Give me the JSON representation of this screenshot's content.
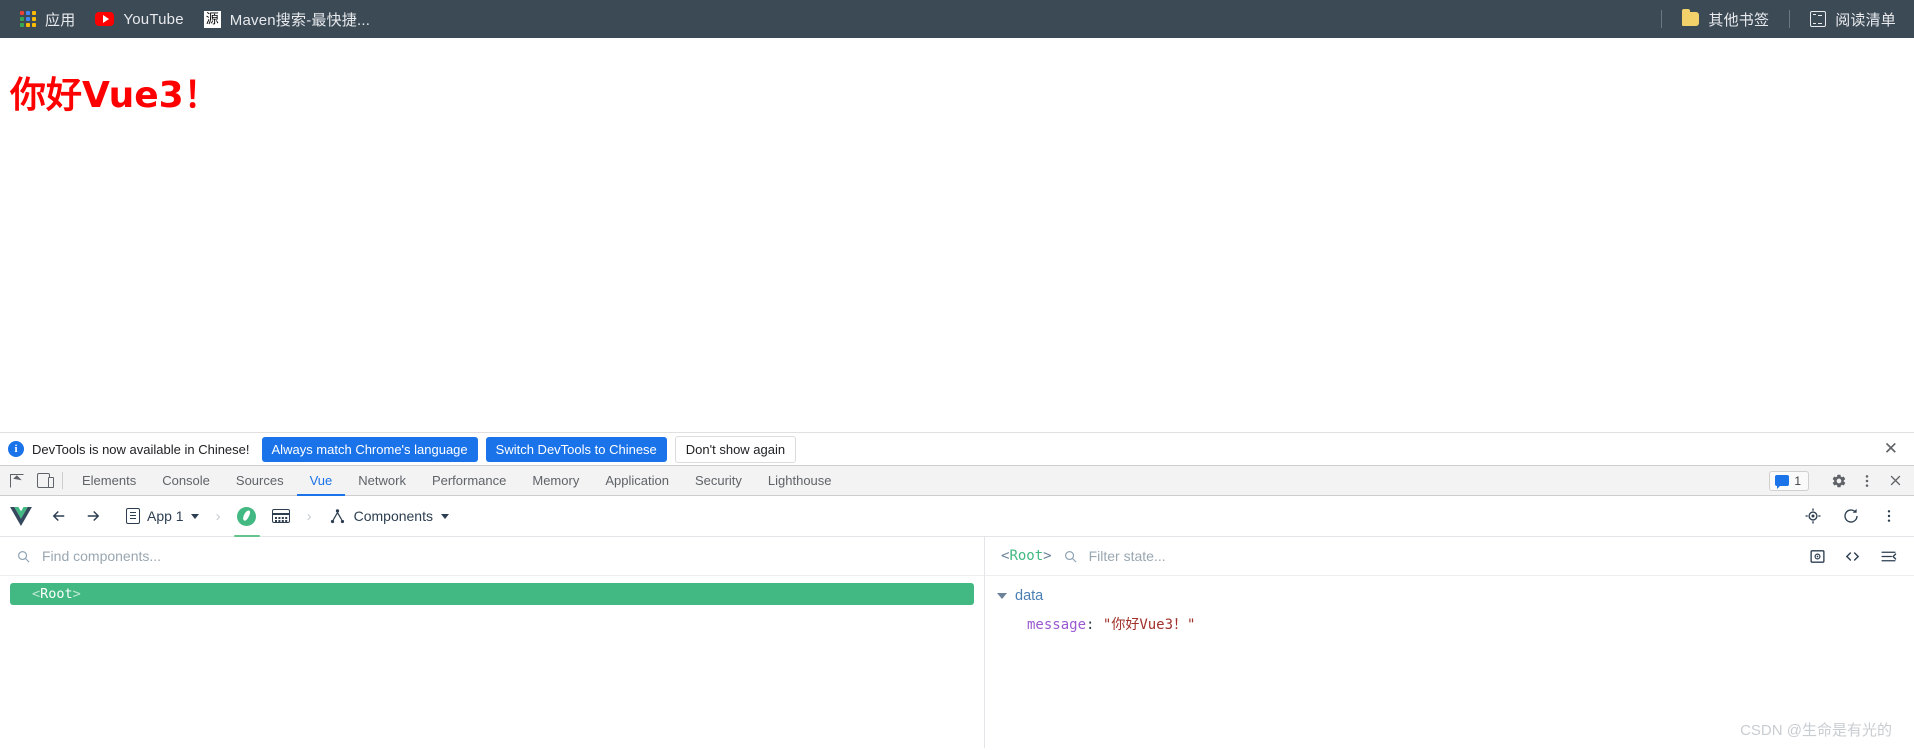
{
  "bookmark_bar": {
    "items": [
      {
        "icon": "apps-grid-icon",
        "label": "应用"
      },
      {
        "icon": "youtube-icon",
        "label": "YouTube"
      },
      {
        "icon": "maven-favicon",
        "favicon_text": "源",
        "label": "Maven搜索-最快捷..."
      }
    ],
    "right": [
      {
        "icon": "folder-icon",
        "label": "其他书签"
      },
      {
        "icon": "reading-list-icon",
        "label": "阅读清单"
      }
    ],
    "background_color": "#3c4a56"
  },
  "page": {
    "heading": "你好Vue3！",
    "heading_color": "#ff0000"
  },
  "devtools_notice": {
    "info_glyph": "i",
    "text": "DevTools is now available in Chinese!",
    "buttons": [
      {
        "label": "Always match Chrome's language",
        "style": "primary"
      },
      {
        "label": "Switch DevTools to Chinese",
        "style": "primary"
      },
      {
        "label": "Don't show again",
        "style": "plain"
      }
    ],
    "close_glyph": "✕",
    "accent_color": "#1a73e8"
  },
  "devtools_tabs": {
    "tools": [
      {
        "icon": "inspect-element-icon"
      },
      {
        "icon": "device-toolbar-icon"
      }
    ],
    "tabs": [
      {
        "label": "Elements",
        "active": false
      },
      {
        "label": "Console",
        "active": false
      },
      {
        "label": "Sources",
        "active": false
      },
      {
        "label": "Vue",
        "active": true
      },
      {
        "label": "Network",
        "active": false
      },
      {
        "label": "Performance",
        "active": false
      },
      {
        "label": "Memory",
        "active": false
      },
      {
        "label": "Application",
        "active": false
      },
      {
        "label": "Security",
        "active": false
      },
      {
        "label": "Lighthouse",
        "active": false
      }
    ],
    "message_count": "1",
    "right_icons": [
      "settings-gear-icon",
      "more-options-icon",
      "close-icon"
    ],
    "active_color": "#1a73e8"
  },
  "vue_toolbar": {
    "logo": "vue-logo",
    "back_glyph": "←",
    "forward_glyph": "→",
    "app_label": "App 1",
    "breadcrumb_sep": "›",
    "view_buttons": [
      {
        "icon": "vue-instance-icon",
        "active": true
      },
      {
        "icon": "render-timeline-icon",
        "active": false
      }
    ],
    "panel_label": "Components",
    "right_icons": [
      "select-component-icon",
      "refresh-icon",
      "more-options-icon"
    ],
    "accent_color": "#42b883"
  },
  "components_panel": {
    "search_placeholder": "Find components...",
    "tree": [
      {
        "label": "Root",
        "open_bracket": "<",
        "close_bracket": ">",
        "selected": true
      }
    ],
    "selected_color": "#42b883"
  },
  "state_panel": {
    "component_name": "Root",
    "open_bracket": "<",
    "close_bracket": ">",
    "filter_placeholder": "Filter state...",
    "icons": [
      "inspect-dom-icon",
      "open-in-editor-icon",
      "collapse-all-icon"
    ],
    "groups": [
      {
        "name": "data",
        "expanded": true,
        "props": [
          {
            "key": "message",
            "separator": ":",
            "value": "\"你好Vue3！\""
          }
        ]
      }
    ]
  },
  "watermark": "CSDN @生命是有光的"
}
